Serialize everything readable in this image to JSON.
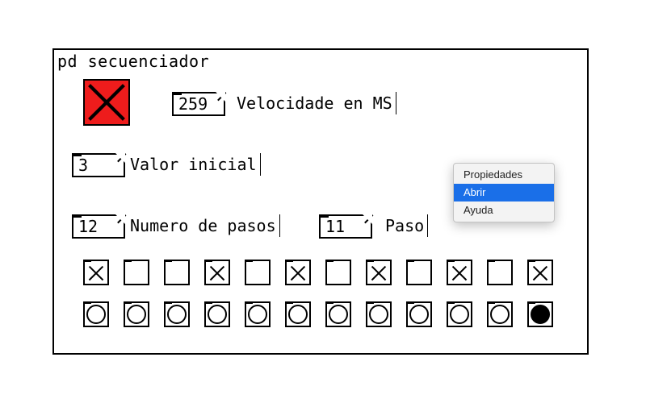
{
  "title": "pd secuenciador",
  "toggle_main": {
    "on": true,
    "bg": "#ee1c1c"
  },
  "speed_ms": {
    "value": "259",
    "label": "Velocidade en MS"
  },
  "init_value": {
    "value": "3",
    "label": "Valor inicial"
  },
  "num_steps": {
    "value": "12",
    "label": "Numero de pasos"
  },
  "current_step": {
    "value": "11",
    "label": "Paso"
  },
  "steps_on": [
    true,
    false,
    false,
    true,
    false,
    true,
    false,
    true,
    false,
    true,
    false,
    true
  ],
  "bangs_fired": [
    false,
    false,
    false,
    false,
    false,
    false,
    false,
    false,
    false,
    false,
    false,
    true
  ],
  "context_menu": {
    "items": [
      "Propiedades",
      "Abrir",
      "Ayuda"
    ],
    "selected_index": 1
  }
}
